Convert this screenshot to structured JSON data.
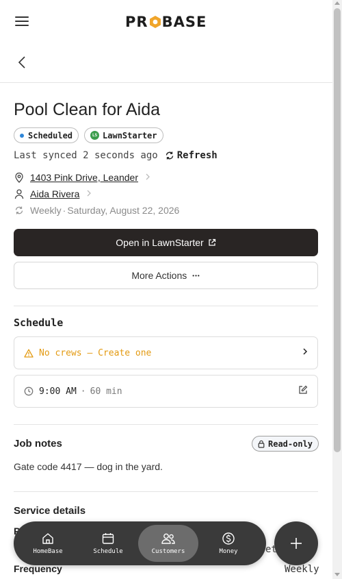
{
  "header": {
    "logo_left": "PR",
    "logo_right": "BASE",
    "menu_icon": "hamburger-icon"
  },
  "nav_back_icon": "chevron-left-icon",
  "job": {
    "title": "Pool Clean for Aida",
    "status_badge": "Scheduled",
    "status_color": "#2f86d8",
    "source_badge": "LawnStarter",
    "source_badge_icon_text": "LS",
    "source_color": "#3c9d4c",
    "sync_text": "Last synced 2 seconds ago",
    "refresh_label": "Refresh",
    "address": "1403 Pink Drive, Leander",
    "customer": "Aida Rivera",
    "recurrence": "Weekly",
    "recurrence_sep": "·",
    "date": "Saturday, August 22, 2026"
  },
  "actions": {
    "primary": "Open in LawnStarter",
    "secondary": "More Actions",
    "secondary_dots": "•••"
  },
  "schedule": {
    "title": "Schedule",
    "crew_warning": "No crews — Create one",
    "time": "9:00 AM",
    "time_sep": "·",
    "duration": "60 min"
  },
  "notes": {
    "title": "Job notes",
    "readonly_label": "Read-only",
    "text": "Gate code 4417 — dog in the yard."
  },
  "service": {
    "title": "Service details",
    "row1_label": "P",
    "row1_value": "et",
    "frequency_label": "Frequency",
    "frequency_value": "Weekly"
  },
  "bottom_nav": {
    "items": [
      {
        "label": "HomeBase",
        "icon": "home-icon"
      },
      {
        "label": "Schedule",
        "icon": "calendar-icon"
      },
      {
        "label": "Customers",
        "icon": "users-icon"
      },
      {
        "label": "Money",
        "icon": "dollar-icon"
      }
    ],
    "active": "Customers",
    "fab_icon": "plus-icon"
  },
  "colors": {
    "accent_dark": "#292524",
    "warning": "#e39a12",
    "logo_hex": "#f0a52a"
  }
}
